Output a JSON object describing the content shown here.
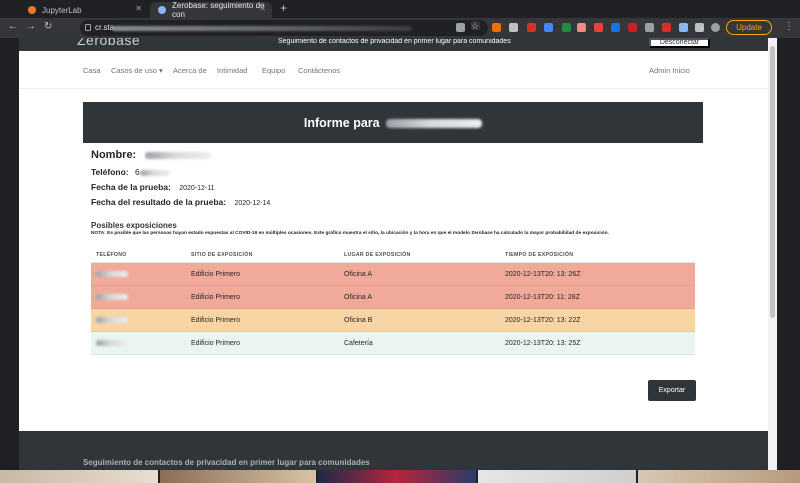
{
  "browser": {
    "tabs": [
      {
        "title": "JupyterLab",
        "active": false
      },
      {
        "title": "Zerobase: seguimiento de con",
        "active": true
      }
    ],
    "url_visible": "cr.sta",
    "update_label": "Update"
  },
  "site": {
    "logo": "Zerobase",
    "tagline": "Seguimiento de contactos de privacidad en primer lugar para comunidades",
    "disconnect_label": "Desconectar",
    "nav": [
      "Casa",
      "Casos de uso",
      "Acerca de",
      "Intimidad",
      "Equipo",
      "Contáctenos"
    ],
    "nav_right": "Admin Inicio"
  },
  "report": {
    "title_prefix": "Informe para",
    "name_label": "Nombre:",
    "phone_label": "Teléfono:",
    "phone_value": "6",
    "test_date_label": "Fecha de la prueba:",
    "test_date_value": "2020-12-11",
    "result_date_label": "Fecha del resultado de la prueba:",
    "result_date_value": "2020-12-14"
  },
  "exposures": {
    "title": "Posibles exposiciones",
    "note": "NOTA: Es posible que las personas hayan estado expuestas al COVID-19 en múltiples ocasiones. Este gráfico muestra el sitio, la ubicación y la hora en que el modelo Zerobase ha calculado la mayor probabilidad de exposición.",
    "columns": [
      "TELÉFONO",
      "SITIO DE EXPOSICIÓN",
      "LUGAR DE EXPOSICIÓN",
      "TIEMPO DE EXPOSICIÓN"
    ],
    "rows": [
      {
        "site": "Edificio Primero",
        "place": "Oficina A",
        "time": "2020-12-13T20: 13: 26Z",
        "risk_color": "#f1aa99"
      },
      {
        "site": "Edificio Primero",
        "place": "Oficina A",
        "time": "2020-12-13T20: 11: 28Z",
        "risk_color": "#f1aa99"
      },
      {
        "site": "Edificio Primero",
        "place": "Oficina B",
        "time": "2020-12-13T20: 13: 22Z",
        "risk_color": "#f8d5a3"
      },
      {
        "site": "Edificio Primero",
        "place": "Cafetería",
        "time": "2020-12-13T20: 13: 25Z",
        "risk_color": "#e9f5ee"
      }
    ],
    "export_label": "Exportar"
  },
  "footer": {
    "text": "Seguimiento de contactos de privacidad en primer lugar para comunidades"
  },
  "colors": {
    "brand_dark": "#2f3539",
    "high_risk": "#f1aa99",
    "medium_risk": "#f8d5a3",
    "low_risk": "#e9f5ee"
  }
}
